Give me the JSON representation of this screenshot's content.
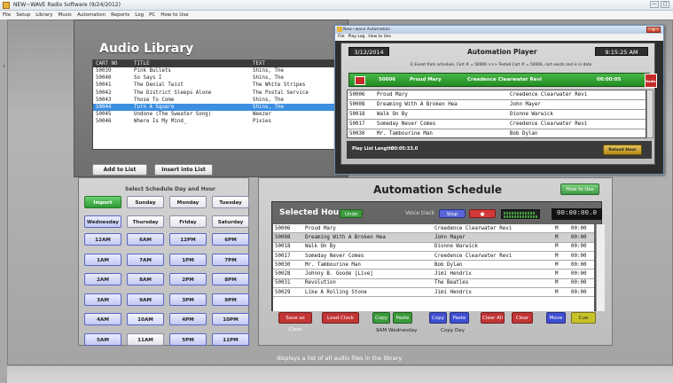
{
  "app": {
    "title": "NEW~WAVE Radio Software (9/24/2012)",
    "menu": [
      "File",
      "Setup",
      "Library",
      "Music",
      "Automation",
      "Reports",
      "Log",
      "PC",
      "How to Use"
    ],
    "left_mark": "›"
  },
  "library": {
    "title": "Audio Library",
    "columns": [
      "CART NO",
      "TITLE",
      "TEXT"
    ],
    "rows": [
      [
        "50039",
        "Pink Bullets",
        "Shins, The"
      ],
      [
        "50040",
        "So Says I",
        "Shins, The"
      ],
      [
        "50041",
        "The Denial Twist",
        "The White Stripes"
      ],
      [
        "50042",
        "The District Sleeps Alone",
        "The Postal Service"
      ],
      [
        "50043",
        "Those To Come",
        "Shins, The"
      ],
      [
        "50044",
        "Turn A Square",
        "Shins, The"
      ],
      [
        "50045",
        "Undone (The Sweater Song)",
        "Weezer"
      ],
      [
        "50046",
        "Where Is My Mind_",
        "Pixies"
      ]
    ],
    "selected_row": 5,
    "add_btn": "Add to List",
    "insert_btn": "Insert into List"
  },
  "day_hour": {
    "title": "Select Schedule Day and Hour",
    "import": "Import",
    "days": [
      "Sunday",
      "Monday",
      "Tuesday",
      "Wednesday",
      "Thursday",
      "Friday",
      "Saturday"
    ],
    "active_day": "Wednesday",
    "hours": [
      "12AM",
      "6AM",
      "12PM",
      "6PM",
      "1AM",
      "7AM",
      "1PM",
      "7PM",
      "2AM",
      "8AM",
      "2PM",
      "8PM",
      "3AM",
      "9AM",
      "3PM",
      "9PM",
      "4AM",
      "10AM",
      "4PM",
      "10PM",
      "5AM",
      "11AM",
      "5PM",
      "11PM"
    ],
    "active_hours": [
      "Wednesday",
      "12AM",
      "6AM",
      "12PM",
      "6PM",
      "1AM",
      "7AM",
      "1PM",
      "7PM",
      "2AM",
      "8AM",
      "2PM",
      "8PM",
      "3AM",
      "9AM",
      "3PM",
      "9PM",
      "4AM",
      "10AM",
      "4PM",
      "10PM",
      "5AM",
      "5PM",
      "11PM"
    ],
    "highlight_hour": "10AM"
  },
  "schedule": {
    "title": "Automation Schedule",
    "how_to": "How to Use",
    "sel_hour": "Selected Hour",
    "undo": "Undo",
    "voice_track": "Voice track",
    "stop": "Stop",
    "rec": "●",
    "timer": "00:00:00.0",
    "rows": [
      [
        "50006",
        "Proud Mary",
        "Creedence Clearwater Revi",
        "M",
        "00:00"
      ],
      [
        "50008",
        "Dreaming With A Broken Hea",
        "John Mayer",
        "M",
        "00:00"
      ],
      [
        "50018",
        "Walk On By",
        "Dionne Warwick",
        "M",
        "00:00"
      ],
      [
        "50017",
        "Someday Never Comes",
        "Creedence Clearwater Revi",
        "M",
        "00:00"
      ],
      [
        "50030",
        "Mr. Tambourine Man",
        "Bob Dylan",
        "M",
        "00:00"
      ],
      [
        "50028",
        "Johnny B. Goode [Live]",
        "Jimi Hendrix",
        "M",
        "00:00"
      ],
      [
        "50031",
        "Revolution",
        "The Beatles",
        "M",
        "00:00"
      ],
      [
        "50029",
        "Like A Rolling Stone",
        "Jimi Hendrix",
        "M",
        "00:00"
      ]
    ],
    "selected_row": 1,
    "buttons": [
      "Save as Clock",
      "Load Clock",
      "Copy",
      "Paste",
      "Copy",
      "Paste",
      "Clear All",
      "Clear",
      "Move",
      "Cue"
    ],
    "foot_hour": "9AM Wednesday",
    "foot_day": "Copy Day"
  },
  "status": {
    "description": "displays a list of all audio files in the library"
  },
  "player": {
    "win_title": "New~wave Automation",
    "menu": [
      "File",
      "Play Log",
      "How to Use"
    ],
    "close": "x",
    "date": "3/12/2014",
    "title": "Automation Player",
    "clock": "9:15:25 AM",
    "event": "1) Event from schedule, Cart # = 50006 >>> Tested Cart # = 50006, cart exists and is in date",
    "now": {
      "cart": "50006",
      "title": "Proud Mary",
      "artist": "Creedence Clearwater Revi",
      "time": "00:00:05",
      "radio": "Radio"
    },
    "rows": [
      [
        "50006",
        "Proud Mary",
        "Creedence Clearwater Revi"
      ],
      [
        "50008",
        "Dreaming With A Broken Hea",
        "John Mayer"
      ],
      [
        "50018",
        "Walk On By",
        "Dionne Warwick"
      ],
      [
        "50017",
        "Someday Never Comes",
        "Creedence Clearwater Revi"
      ],
      [
        "50030",
        "Mr. Tambourine Man",
        "Bob Dylan"
      ]
    ],
    "play_length_label": "Play List Length:",
    "play_length": "00:05:33.0",
    "reload": "Reload Hour"
  }
}
